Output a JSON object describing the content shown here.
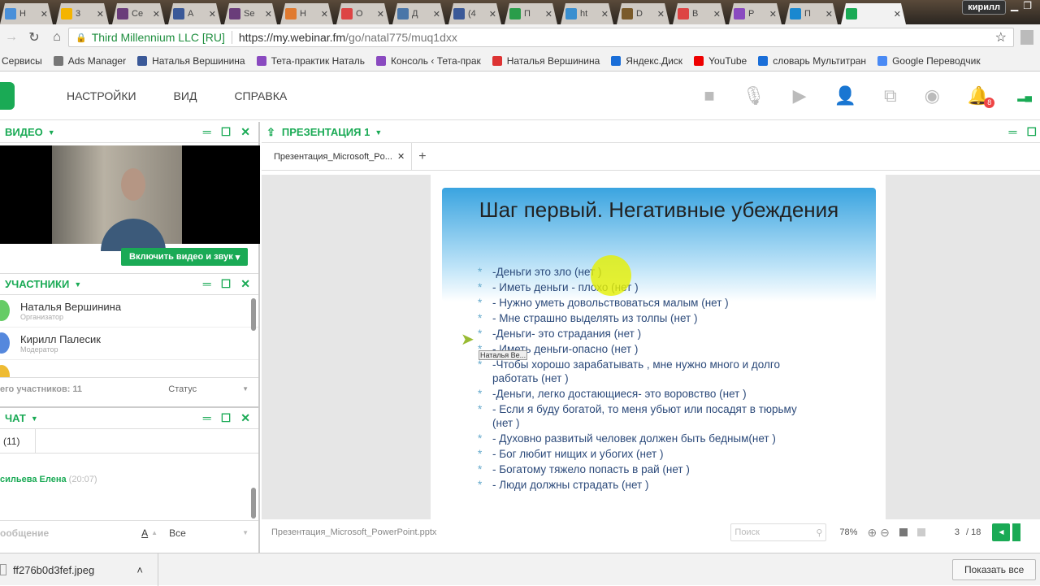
{
  "browser": {
    "tabs": [
      {
        "label": "Н",
        "color": "#4a90d9"
      },
      {
        "label": "3",
        "color": "#f4b400"
      },
      {
        "label": "Се",
        "color": "#6a3d7a"
      },
      {
        "label": "А",
        "color": "#3b5998"
      },
      {
        "label": "Se",
        "color": "#6a3d7a"
      },
      {
        "label": "Н",
        "color": "#e07a30"
      },
      {
        "label": "О",
        "color": "#d44"
      },
      {
        "label": "Д",
        "color": "#4a76a8"
      },
      {
        "label": "(4",
        "color": "#3b5998"
      },
      {
        "label": "П",
        "color": "#2a9d4a"
      },
      {
        "label": "ht",
        "color": "#3a8fd0"
      },
      {
        "label": "D",
        "color": "#7a5a2a"
      },
      {
        "label": "В",
        "color": "#d44"
      },
      {
        "label": "Р",
        "color": "#8a4ac0"
      },
      {
        "label": "П",
        "color": "#1a88d0"
      },
      {
        "label": "",
        "color": "#1aaa55"
      }
    ],
    "user": "кирилл",
    "secure_label": "Third Millennium LLC [RU]",
    "url_host": "https://my.webinar.fm",
    "url_path": "/go/natal775/muq1dxx",
    "bookmarks": [
      "Сервисы",
      "Ads Manager",
      "Наталья Вершинина",
      "Тета-практик Наталь",
      "Консоль ‹ Тета-прак",
      "Наталья Вершинина",
      "Яндекс.Диск",
      "YouTube",
      "словарь Мультитран",
      "Google Переводчик"
    ]
  },
  "app": {
    "menu": [
      "НАСТРОЙКИ",
      "ВИД",
      "СПРАВКА"
    ],
    "notif_count": "8",
    "video": {
      "title": "ВИДЕО",
      "button": "Включить видео и звук"
    },
    "participants": {
      "title": "УЧАСТНИКИ",
      "list": [
        {
          "name": "Наталья Вершинина",
          "role": "Организатор"
        },
        {
          "name": "Кирилл Палесик",
          "role": "Модератор"
        }
      ],
      "total": "его участников: 11",
      "status": "Статус"
    },
    "chat": {
      "title": "ЧАТ",
      "tab": "(11)",
      "message_author": "сильева Елена",
      "message_time": "(20:07)",
      "input_placeholder": "ообщение",
      "font_label": "A",
      "recipient": "Все"
    },
    "presentation": {
      "title": "ПРЕЗЕНТАЦИЯ 1",
      "tab": "Презентация_Microsoft_Po...",
      "file": "Презентация_Microsoft_PowerPoint.pptx",
      "search_placeholder": "Поиск",
      "zoom": "78%",
      "page": "3",
      "total": "/ 18"
    },
    "slide": {
      "title": "Шаг первый. Негативные убеждения",
      "items": [
        "-Деньги это зло (нет )",
        "- Иметь деньги - плохо (нет )",
        "- Нужно уметь довольствоваться малым (нет )",
        "- Мне страшно выделять из толпы (нет )",
        "-Деньги- это страдания (нет )",
        "- Иметь деньги-опасно (нет )",
        "-Чтобы хорошо зарабатывать , мне нужно много и долго работать (нет )",
        "-Деньги, легко достающиеся- это воровство (нет )",
        "- Если я буду богатой, то меня убьют или посадят в тюрьму (нет )",
        "- Духовно развитый человек должен быть бедным(нет )",
        "- Бог любит нищих и убогих (нет )",
        "- Богатому тяжело попасть в рай (нет )",
        "- Люди должны страдать (нет )"
      ],
      "cursor_tip": "Наталья Ве..."
    }
  },
  "downloads": {
    "file": "ff276b0d3fef.jpeg",
    "show_all": "Показать все"
  }
}
